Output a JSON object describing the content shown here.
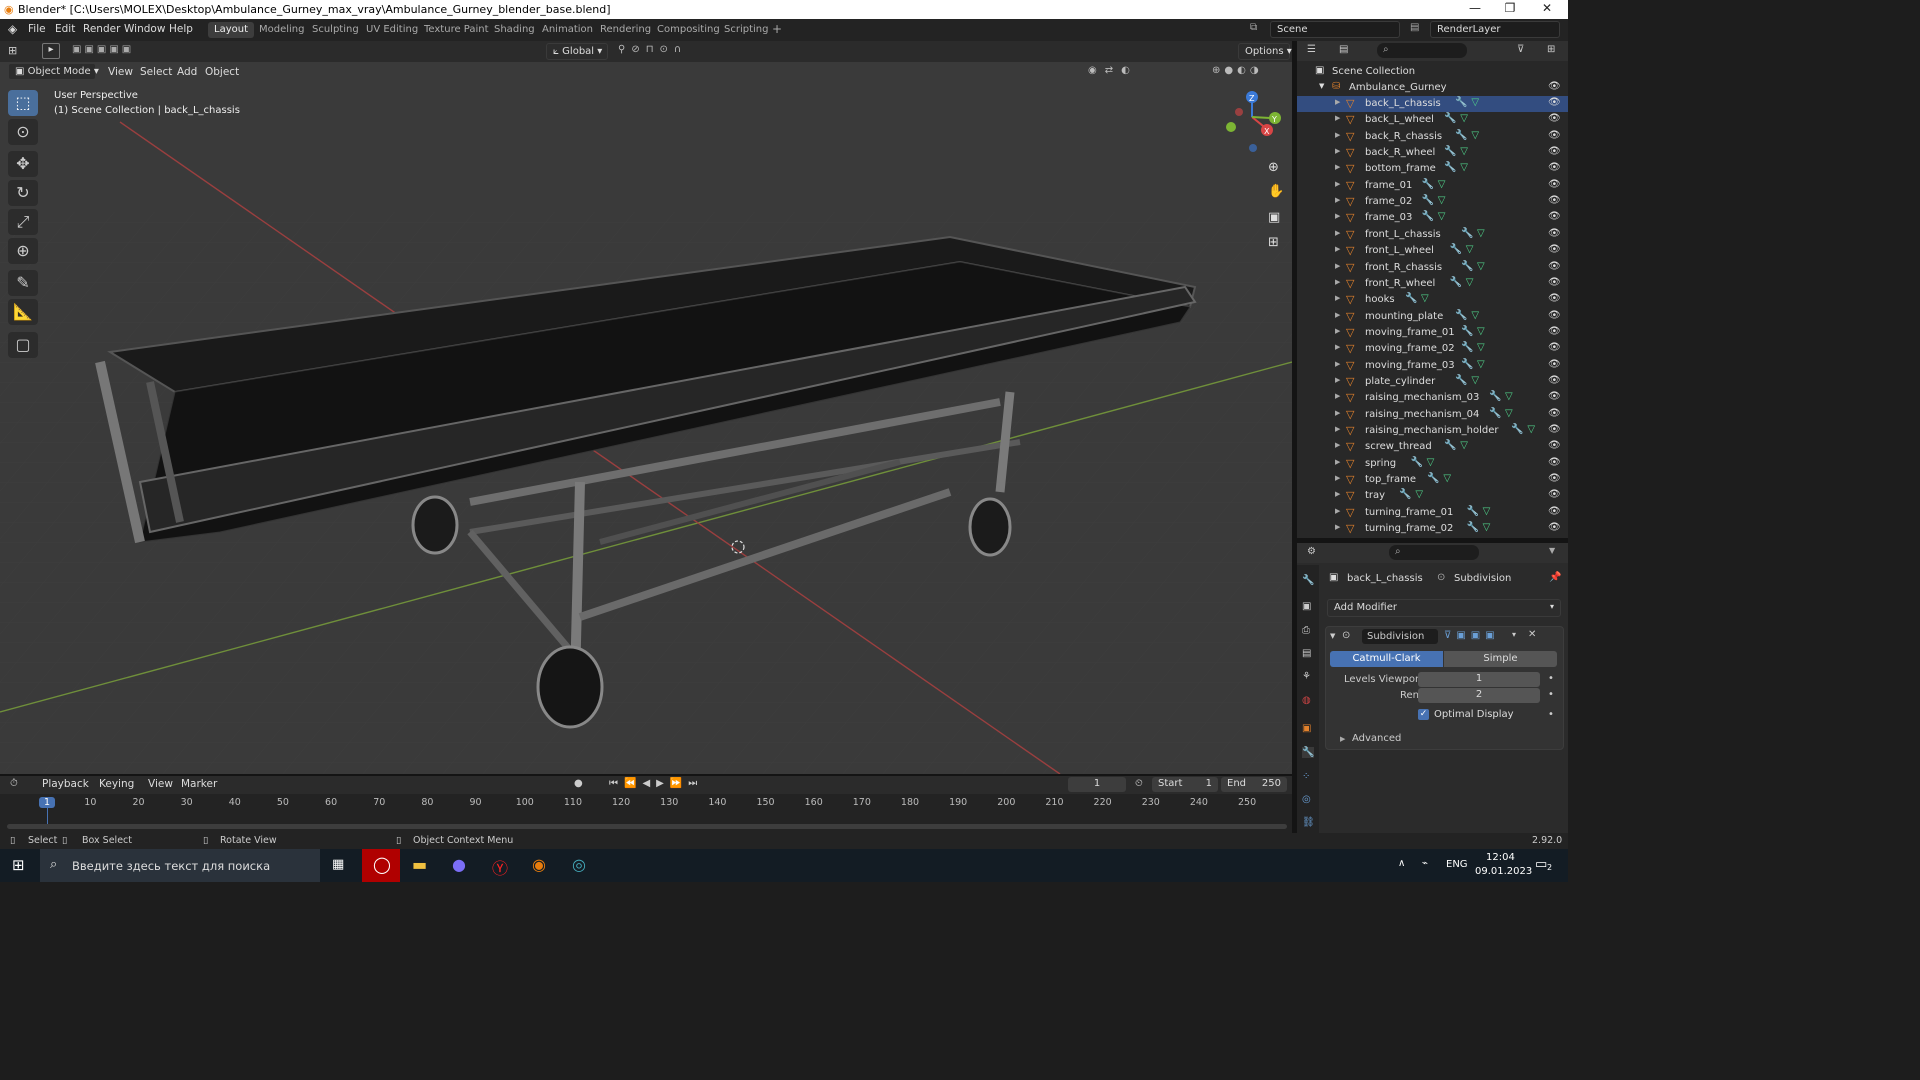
{
  "window": {
    "title": "Blender* [C:\\Users\\MOLEX\\Desktop\\Ambulance_Gurney_max_vray\\Ambulance_Gurney_blender_base.blend]",
    "min": "—",
    "max": "❐",
    "close": "✕"
  },
  "menubar": {
    "items": [
      "File",
      "Edit",
      "Render",
      "Window",
      "Help"
    ]
  },
  "workspaces": [
    "Layout",
    "Modeling",
    "Sculpting",
    "UV Editing",
    "Texture Paint",
    "Shading",
    "Animation",
    "Rendering",
    "Compositing",
    "Scripting"
  ],
  "workspace_active": "Layout",
  "scene": {
    "name": "Scene",
    "render_layer": "RenderLayer"
  },
  "viewport_header": {
    "transform": "Global",
    "options": "Options",
    "mode": "Object Mode",
    "menus": [
      "View",
      "Select",
      "Add",
      "Object"
    ]
  },
  "viewport": {
    "perspective": "User Perspective",
    "collection_info": "(1) Scene Collection | back_L_chassis",
    "axes": {
      "x": "X",
      "y": "Y",
      "z": "Z"
    }
  },
  "outliner": {
    "root": "Scene Collection",
    "collection": "Ambulance_Gurney",
    "items": [
      "back_L_chassis",
      "back_L_wheel",
      "back_R_chassis",
      "back_R_wheel",
      "bottom_frame",
      "frame_01",
      "frame_02",
      "frame_03",
      "front_L_chassis",
      "front_L_wheel",
      "front_R_chassis",
      "front_R_wheel",
      "hooks",
      "mounting_plate",
      "moving_frame_01",
      "moving_frame_02",
      "moving_frame_03",
      "plate_cylinder",
      "raising_mechanism_03",
      "raising_mechanism_04",
      "raising_mechanism_holder",
      "screw_thread",
      "spring",
      "top_frame",
      "tray",
      "turning_frame_01",
      "turning_frame_02"
    ]
  },
  "properties": {
    "object": "back_L_chassis",
    "modifier_label": "Subdivision",
    "add_modifier": "Add Modifier",
    "modifier_name": "Subdivision",
    "method_a": "Catmull-Clark",
    "method_b": "Simple",
    "levels_viewport_label": "Levels Viewport",
    "levels_viewport": "1",
    "render_label": "Render",
    "render": "2",
    "optimal_display": "Optimal Display",
    "advanced": "Advanced"
  },
  "timeline": {
    "menus": [
      "Playback",
      "Keying",
      "View",
      "Marker"
    ],
    "current": "1",
    "start_label": "Start",
    "start": "1",
    "end_label": "End",
    "end": "250",
    "ticks": [
      "1",
      "10",
      "20",
      "30",
      "40",
      "50",
      "60",
      "70",
      "80",
      "90",
      "100",
      "110",
      "120",
      "130",
      "140",
      "150",
      "160",
      "170",
      "180",
      "190",
      "200",
      "210",
      "220",
      "230",
      "240",
      "250"
    ]
  },
  "statusbar": {
    "select": "Select",
    "box": "Box Select",
    "rotate": "Rotate View",
    "context": "Object Context Menu",
    "version": "2.92.0"
  },
  "taskbar": {
    "search": "Введите здесь текст для поиска",
    "lang": "ENG",
    "time": "12:04",
    "date": "09.01.2023",
    "notif": "2"
  }
}
